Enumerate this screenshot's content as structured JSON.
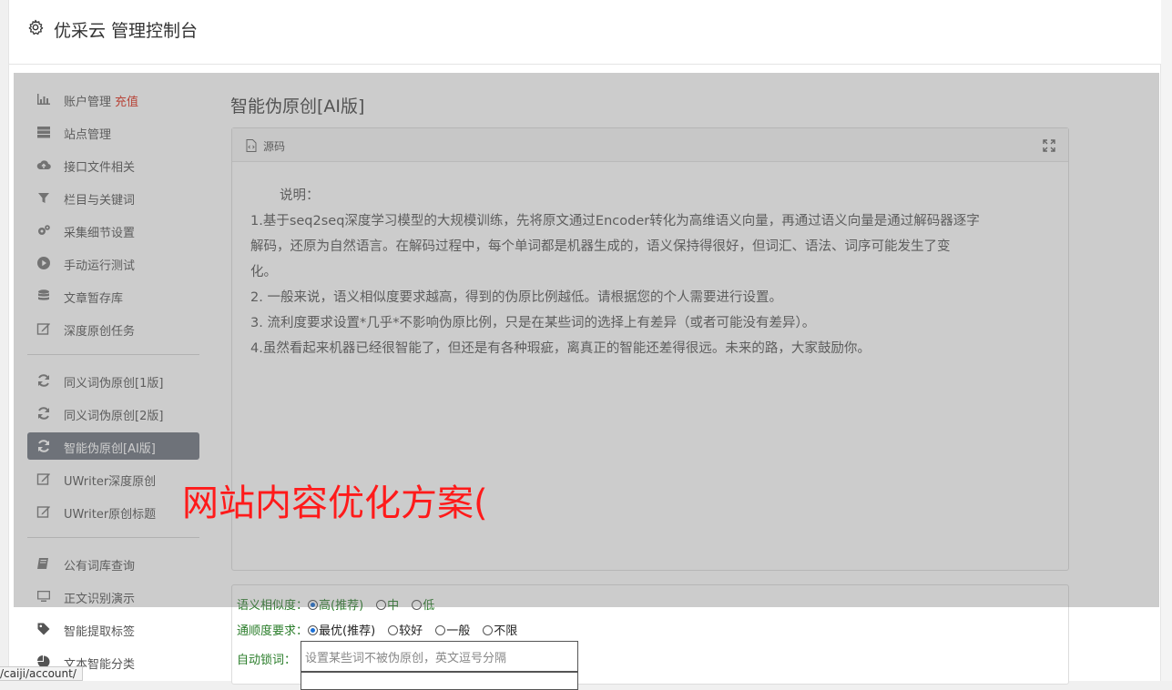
{
  "header": {
    "title": "优采云 管理控制台",
    "icon": "gear-icon"
  },
  "sidebar": {
    "group1": [
      {
        "label": "账户管理",
        "extra": "充值",
        "icon": "bar-chart-icon",
        "accent": "#e0301e"
      },
      {
        "label": "站点管理",
        "icon": "server-icon"
      },
      {
        "label": "接口文件相关",
        "icon": "cloud-upload-icon"
      },
      {
        "label": "栏目与关键词",
        "icon": "filter-icon"
      },
      {
        "label": "采集细节设置",
        "icon": "gears-icon"
      },
      {
        "label": "手动运行测试",
        "icon": "play-icon"
      },
      {
        "label": "文章暂存库",
        "icon": "database-icon"
      },
      {
        "label": "深度原创任务",
        "icon": "edit-icon"
      }
    ],
    "group2": [
      {
        "label": "同义词伪原创[1版]",
        "icon": "refresh-icon"
      },
      {
        "label": "同义词伪原创[2版]",
        "icon": "refresh-icon"
      },
      {
        "label": "智能伪原创[AI版]",
        "icon": "refresh-icon",
        "active": true
      },
      {
        "label": "UWriter深度原创",
        "icon": "edit-icon"
      },
      {
        "label": "UWriter原创标题",
        "icon": "edit-icon"
      }
    ],
    "group3": [
      {
        "label": "公有词库查询",
        "icon": "book-icon"
      },
      {
        "label": "正文识别演示",
        "icon": "monitor-icon"
      },
      {
        "label": "智能提取标签",
        "icon": "tag-icon"
      },
      {
        "label": "文本智能分类",
        "icon": "pie-chart-icon"
      }
    ]
  },
  "main": {
    "title": "智能伪原创[AI版]",
    "panel": {
      "tab_label": "源码",
      "intro": "说明：",
      "lines": [
        "1.基于seq2seq深度学习模型的大规模训练，先将原文通过Encoder转化为高维语义向量，再通过语义向量是通过解码器逐字",
        "解码，还原为自然语言。在解码过程中，每个单词都是机器生成的，语义保持得很好，但词汇、语法、词序可能发生了变",
        "化。",
        "2. 一般来说，语义相似度要求越高，得到的伪原比例越低。请根据您的个人需要进行设置。",
        "3. 流利度要求设置*几乎*不影响伪原比例，只是在某些词的选择上有差异（或者可能没有差异）。",
        "4.虽然看起来机器已经很智能了，但还是有各种瑕疵，离真正的智能还差得很远。未来的路，大家鼓励你。"
      ]
    },
    "form": {
      "similarity_label": "语义相似度：",
      "similarity_options": [
        "高(推荐)",
        "中",
        "低"
      ],
      "fluency_label": "通顺度要求：",
      "fluency_options": [
        "最优(推荐)",
        "较好",
        "一般",
        "不限"
      ],
      "lock_label": "自动锁词：",
      "lock_placeholder": "设置某些词不被伪原创，英文逗号分隔"
    }
  },
  "watermark": "网站内容优化方案(",
  "status_url": "/caiji/account/"
}
